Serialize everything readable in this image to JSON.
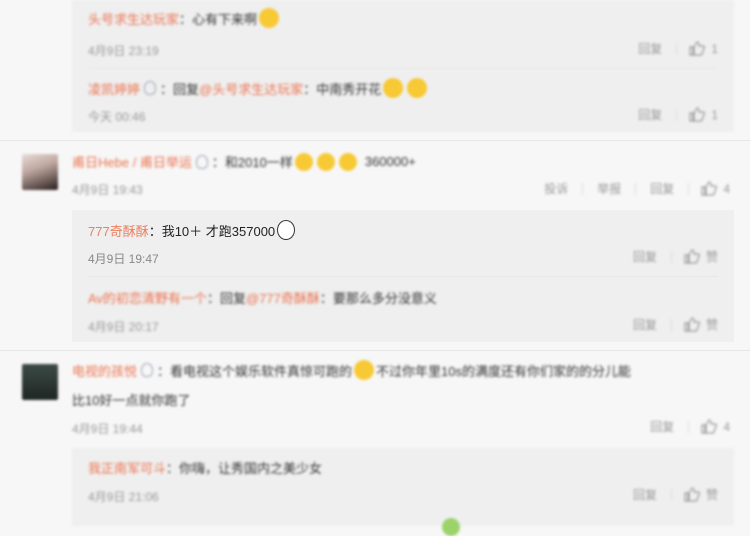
{
  "c1": {
    "r1": {
      "user": "头号求生达玩家",
      "colon": "：",
      "text": "心有下来啊",
      "time": "4月9日 23:19",
      "reply": "回复",
      "likes": "1"
    },
    "r2": {
      "user": "凌凯婷婷",
      "colon": "：",
      "reply_prefix": "回复",
      "mention": "@头号求生达玩家",
      "text": "：中南秀开花",
      "time": "今天 00:46",
      "reply": "回复",
      "likes": "1"
    }
  },
  "c2": {
    "user": "甫日Hebe / 甫日举运",
    "text": "：和2010一样",
    "text_after": "360000+",
    "time": "4月9日 19:43",
    "actions": [
      "投诉",
      "举报",
      "回复"
    ],
    "likes": "4",
    "r1": {
      "user": "777奇酥酥",
      "text": "：我10＋ 才跑357000",
      "time": "4月9日 19:47",
      "reply": "回复",
      "like_label": "赞"
    },
    "r2": {
      "user": "Av的初恋清野有一个",
      "colon": "：",
      "reply_prefix": "回复",
      "mention": "@777奇酥酥",
      "text": "：要那么多分没意义",
      "time": "4月9日 20:17",
      "reply": "回复",
      "like_label": "赞"
    }
  },
  "c3": {
    "user": "电视的孩悦",
    "text": "：看电视这个娱乐软件真惊可跑的",
    "text_tail": "不过你年里10s的满度还有你们家的的分儿能",
    "text_line2": "比10好一点就你跑了",
    "time": "4月9日 19:44",
    "reply": "回复",
    "likes": "4",
    "r1": {
      "user": "我正南军可斗",
      "colon": "：",
      "text": "你嗨，让秀国内之美少女",
      "time": "4月9日 21:06",
      "reply": "回复",
      "like_label": "赞"
    }
  },
  "colors": {
    "name": "#eb7350",
    "meta": "#999999",
    "sub_bg": "#efefef",
    "page_bg": "#f7f7f7"
  },
  "icons": [
    "thumb-up-icon",
    "vip-badge-icon",
    "doge-emoji-icon",
    "smile-emoji-icon",
    "gogo-emoji-icon"
  ]
}
